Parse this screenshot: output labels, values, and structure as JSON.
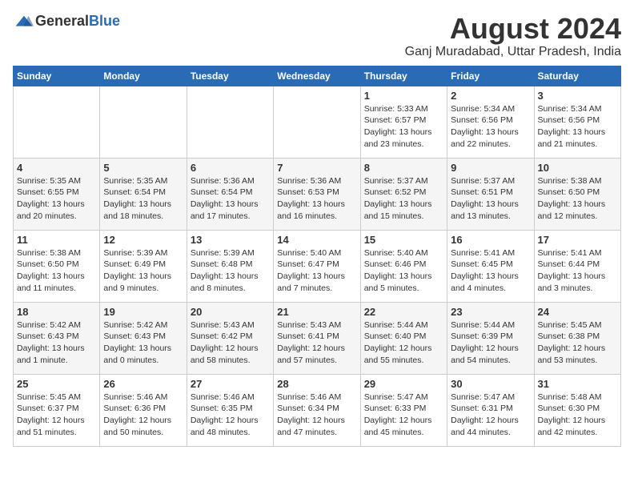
{
  "header": {
    "logo_general": "General",
    "logo_blue": "Blue",
    "month_year": "August 2024",
    "location": "Ganj Muradabad, Uttar Pradesh, India"
  },
  "days_of_week": [
    "Sunday",
    "Monday",
    "Tuesday",
    "Wednesday",
    "Thursday",
    "Friday",
    "Saturday"
  ],
  "weeks": [
    [
      {
        "day": "",
        "info": ""
      },
      {
        "day": "",
        "info": ""
      },
      {
        "day": "",
        "info": ""
      },
      {
        "day": "",
        "info": ""
      },
      {
        "day": "1",
        "info": "Sunrise: 5:33 AM\nSunset: 6:57 PM\nDaylight: 13 hours\nand 23 minutes."
      },
      {
        "day": "2",
        "info": "Sunrise: 5:34 AM\nSunset: 6:56 PM\nDaylight: 13 hours\nand 22 minutes."
      },
      {
        "day": "3",
        "info": "Sunrise: 5:34 AM\nSunset: 6:56 PM\nDaylight: 13 hours\nand 21 minutes."
      }
    ],
    [
      {
        "day": "4",
        "info": "Sunrise: 5:35 AM\nSunset: 6:55 PM\nDaylight: 13 hours\nand 20 minutes."
      },
      {
        "day": "5",
        "info": "Sunrise: 5:35 AM\nSunset: 6:54 PM\nDaylight: 13 hours\nand 18 minutes."
      },
      {
        "day": "6",
        "info": "Sunrise: 5:36 AM\nSunset: 6:54 PM\nDaylight: 13 hours\nand 17 minutes."
      },
      {
        "day": "7",
        "info": "Sunrise: 5:36 AM\nSunset: 6:53 PM\nDaylight: 13 hours\nand 16 minutes."
      },
      {
        "day": "8",
        "info": "Sunrise: 5:37 AM\nSunset: 6:52 PM\nDaylight: 13 hours\nand 15 minutes."
      },
      {
        "day": "9",
        "info": "Sunrise: 5:37 AM\nSunset: 6:51 PM\nDaylight: 13 hours\nand 13 minutes."
      },
      {
        "day": "10",
        "info": "Sunrise: 5:38 AM\nSunset: 6:50 PM\nDaylight: 13 hours\nand 12 minutes."
      }
    ],
    [
      {
        "day": "11",
        "info": "Sunrise: 5:38 AM\nSunset: 6:50 PM\nDaylight: 13 hours\nand 11 minutes."
      },
      {
        "day": "12",
        "info": "Sunrise: 5:39 AM\nSunset: 6:49 PM\nDaylight: 13 hours\nand 9 minutes."
      },
      {
        "day": "13",
        "info": "Sunrise: 5:39 AM\nSunset: 6:48 PM\nDaylight: 13 hours\nand 8 minutes."
      },
      {
        "day": "14",
        "info": "Sunrise: 5:40 AM\nSunset: 6:47 PM\nDaylight: 13 hours\nand 7 minutes."
      },
      {
        "day": "15",
        "info": "Sunrise: 5:40 AM\nSunset: 6:46 PM\nDaylight: 13 hours\nand 5 minutes."
      },
      {
        "day": "16",
        "info": "Sunrise: 5:41 AM\nSunset: 6:45 PM\nDaylight: 13 hours\nand 4 minutes."
      },
      {
        "day": "17",
        "info": "Sunrise: 5:41 AM\nSunset: 6:44 PM\nDaylight: 13 hours\nand 3 minutes."
      }
    ],
    [
      {
        "day": "18",
        "info": "Sunrise: 5:42 AM\nSunset: 6:43 PM\nDaylight: 13 hours\nand 1 minute."
      },
      {
        "day": "19",
        "info": "Sunrise: 5:42 AM\nSunset: 6:43 PM\nDaylight: 13 hours\nand 0 minutes."
      },
      {
        "day": "20",
        "info": "Sunrise: 5:43 AM\nSunset: 6:42 PM\nDaylight: 12 hours\nand 58 minutes."
      },
      {
        "day": "21",
        "info": "Sunrise: 5:43 AM\nSunset: 6:41 PM\nDaylight: 12 hours\nand 57 minutes."
      },
      {
        "day": "22",
        "info": "Sunrise: 5:44 AM\nSunset: 6:40 PM\nDaylight: 12 hours\nand 55 minutes."
      },
      {
        "day": "23",
        "info": "Sunrise: 5:44 AM\nSunset: 6:39 PM\nDaylight: 12 hours\nand 54 minutes."
      },
      {
        "day": "24",
        "info": "Sunrise: 5:45 AM\nSunset: 6:38 PM\nDaylight: 12 hours\nand 53 minutes."
      }
    ],
    [
      {
        "day": "25",
        "info": "Sunrise: 5:45 AM\nSunset: 6:37 PM\nDaylight: 12 hours\nand 51 minutes."
      },
      {
        "day": "26",
        "info": "Sunrise: 5:46 AM\nSunset: 6:36 PM\nDaylight: 12 hours\nand 50 minutes."
      },
      {
        "day": "27",
        "info": "Sunrise: 5:46 AM\nSunset: 6:35 PM\nDaylight: 12 hours\nand 48 minutes."
      },
      {
        "day": "28",
        "info": "Sunrise: 5:46 AM\nSunset: 6:34 PM\nDaylight: 12 hours\nand 47 minutes."
      },
      {
        "day": "29",
        "info": "Sunrise: 5:47 AM\nSunset: 6:33 PM\nDaylight: 12 hours\nand 45 minutes."
      },
      {
        "day": "30",
        "info": "Sunrise: 5:47 AM\nSunset: 6:31 PM\nDaylight: 12 hours\nand 44 minutes."
      },
      {
        "day": "31",
        "info": "Sunrise: 5:48 AM\nSunset: 6:30 PM\nDaylight: 12 hours\nand 42 minutes."
      }
    ]
  ]
}
